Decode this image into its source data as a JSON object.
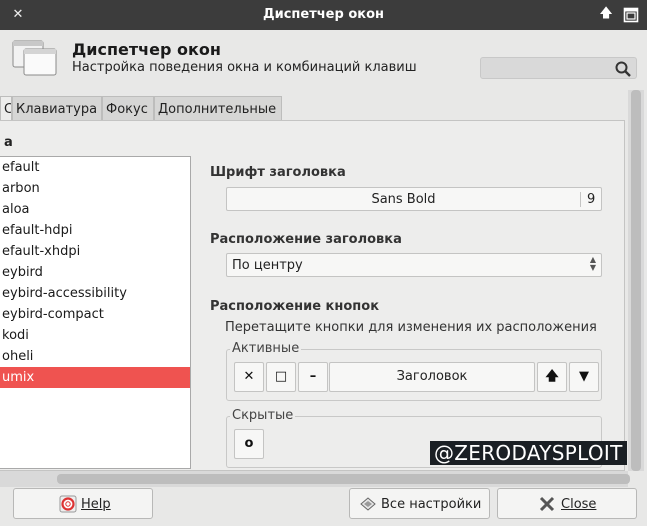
{
  "titlebar": {
    "title": "Диспетчер окон",
    "close_glyph": "✕",
    "up_glyph": "🡅"
  },
  "header": {
    "title": "Диспетчер окон",
    "subtitle": "Настройка поведения окна и комбинаций клавиш",
    "search_placeholder": ""
  },
  "tabs": [
    {
      "label": "Стиль",
      "active": true
    },
    {
      "label": "Клавиатура",
      "active": false
    },
    {
      "label": "Фокус",
      "active": false
    },
    {
      "label": "Дополнительные",
      "active": false
    }
  ],
  "theme_list": {
    "title": "а",
    "items": [
      "efault",
      "arbon",
      "aloa",
      "efault-hdpi",
      "efault-xhdpi",
      "eybird",
      "eybird-accessibility",
      "eybird-compact",
      "kodi",
      "oheli",
      "umix"
    ],
    "selected_index": 10
  },
  "title_font": {
    "heading": "Шрифт заголовка",
    "font_name": "Sans Bold",
    "font_size": "9"
  },
  "title_alignment": {
    "heading": "Расположение заголовка",
    "value": "По центру"
  },
  "button_layout": {
    "heading": "Расположение кнопок",
    "hint": "Перетащите кнопки для изменения их расположения",
    "active_label": "Активные",
    "hidden_label": "Скрытые",
    "active_buttons": [
      "✕",
      "□",
      "–"
    ],
    "title_button": "Заголовок",
    "right_buttons": [
      "🡅",
      "▼"
    ],
    "hidden_buttons": [
      "o"
    ]
  },
  "watermark": "@ZERODAYSPLOIT",
  "footer": {
    "help_label": "Help",
    "settings_label": "Все настройки",
    "close_label": "Close"
  },
  "colors": {
    "titlebar": "#3c3c3c",
    "selection": "#ef5350",
    "window_bg": "#e8e8e7"
  }
}
